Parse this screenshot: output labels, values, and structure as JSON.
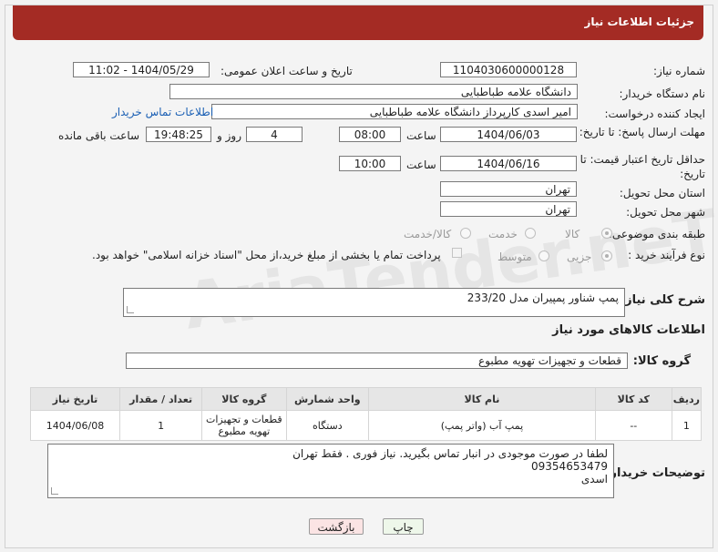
{
  "page_title": "جزئیات اطلاعات نیاز",
  "fields": {
    "need_number_label": "شماره نیاز:",
    "need_number": "1104030600000128",
    "announce_label": "تاریخ و ساعت اعلان عمومی:",
    "announce_value": "1404/05/29 - 11:02",
    "buyer_label": "نام دستگاه خریدار:",
    "buyer_value": "دانشگاه علامه طباطبایی",
    "creator_label": "ایجاد کننده درخواست:",
    "creator_value": "امیر اسدی کارپرداز دانشگاه علامه طباطبایی",
    "contact_link": "اطلاعات تماس خریدار",
    "deadline_label": "مهلت ارسال پاسخ: تا تاریخ:",
    "deadline_date": "1404/06/03",
    "time_label": "ساعت",
    "deadline_time": "08:00",
    "days_value": "4",
    "days_label": "روز و",
    "remaining_time": "19:48:25",
    "remaining_label": "ساعت باقی مانده",
    "validity_label": "حداقل تاریخ اعتبار قیمت: تا تاریخ:",
    "validity_date": "1404/06/16",
    "validity_time": "10:00",
    "province_label": "استان محل تحویل:",
    "province_value": "تهران",
    "city_label": "شهر محل تحویل:",
    "city_value": "تهران",
    "category_label": "طبقه بندی موضوعی:",
    "category_options": [
      "کالا",
      "خدمت",
      "کالا/خدمت"
    ],
    "process_label": "نوع فرآیند خرید :",
    "process_options": [
      "جزیی",
      "متوسط"
    ],
    "payment_note": "پرداخت تمام یا بخشی از مبلغ خرید،از محل \"اسناد خزانه اسلامی\" خواهد بود."
  },
  "description": {
    "label": "شرح کلی نیاز:",
    "value": "پمپ شناور پمپیران مدل 233/20"
  },
  "goods_section_title": "اطلاعات کالاهای مورد نیاز",
  "goods_group": {
    "label": "گروه کالا:",
    "value": "قطعات و تجهیزات تهویه مطبوع"
  },
  "table": {
    "headers": [
      "ردیف",
      "کد کالا",
      "نام کالا",
      "واحد شمارش",
      "گروه کالا",
      "تعداد / مقدار",
      "تاریخ نیاز"
    ],
    "rows": [
      {
        "row": "1",
        "code": "--",
        "name": "پمپ آب (واتر پمپ)",
        "unit": "دستگاه",
        "group": "قطعات و تجهیزات تهویه مطبوع",
        "qty": "1",
        "date": "1404/06/08"
      }
    ]
  },
  "buyer_notes": {
    "label": "توضیحات خریدار:",
    "lines": [
      "لطفا در صورت موجودی در انبار تماس بگیرید. نیاز فوری . فقط تهران",
      "09354653479",
      "اسدی"
    ]
  },
  "buttons": {
    "print": "چاپ",
    "back": "بازگشت"
  },
  "watermark": "AriaTender.neT"
}
